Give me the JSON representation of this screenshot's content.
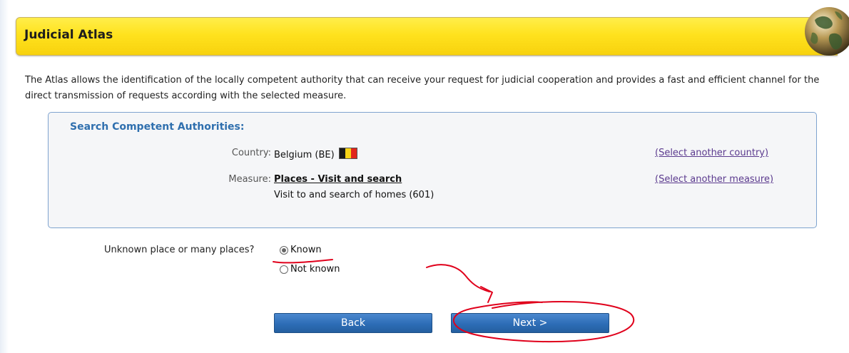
{
  "header": {
    "title": "Judicial Atlas"
  },
  "intro": {
    "text": "The Atlas allows the identification of the locally competent authority that can receive your request for judicial cooperation and provides a fast and efficient channel for the direct transmission of requests according with the selected measure."
  },
  "search": {
    "title": "Search Competent Authorities:",
    "country_label": "Country:",
    "country_value": "Belgium (BE)",
    "country_link": "(Select another country)",
    "measure_label": "Measure:",
    "measure_name": "Places - Visit and search",
    "measure_detail": "Visit to and search of homes (601)",
    "measure_link": "(Select another measure)"
  },
  "place": {
    "question": "Unknown place or many places?",
    "options": [
      "Known",
      "Not known"
    ],
    "selected": "Known"
  },
  "buttons": {
    "back": "Back",
    "next": "Next >"
  },
  "colors": {
    "title_bar": "#ffe21e",
    "box_title": "#2f6fae",
    "button": "#2d6db6",
    "link": "#5b3a8e",
    "annotation": "#e0001b",
    "flag": [
      "#1a1a1a",
      "#f7d417",
      "#e1261c"
    ]
  }
}
